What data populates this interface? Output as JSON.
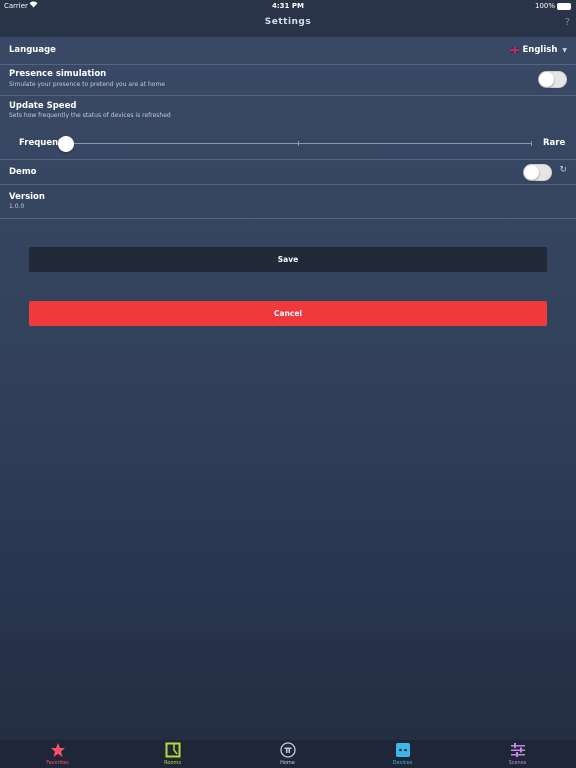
{
  "status_bar": {
    "carrier": "Carrier",
    "time": "4:31 PM",
    "battery": "100%"
  },
  "nav": {
    "title": "Settings",
    "help": "?"
  },
  "settings": {
    "language": {
      "label": "Language",
      "value": "English"
    },
    "presence": {
      "label": "Presence simulation",
      "description": "Simulate your presence to pretend you are at home",
      "enabled": false
    },
    "update_speed": {
      "label": "Update Speed",
      "description": "Sets how frequently the status of devices is refreshed",
      "min_label": "Frequent",
      "max_label": "Rare",
      "value_fraction": 0
    },
    "demo": {
      "label": "Demo",
      "enabled": false
    },
    "version": {
      "label": "Version",
      "value": "1.0.0"
    }
  },
  "buttons": {
    "save": "Save",
    "cancel": "Cancel"
  },
  "tabs": [
    {
      "label": "Favorites",
      "icon": "star-icon",
      "color": "#ff4f6e"
    },
    {
      "label": "Rooms",
      "icon": "room-icon",
      "color": "#b5dc3b"
    },
    {
      "label": "Home",
      "icon": "home-logo-icon",
      "color": "#c3cad6"
    },
    {
      "label": "Devices",
      "icon": "device-icon",
      "color": "#3fb7e6"
    },
    {
      "label": "Scenes",
      "icon": "sliders-icon",
      "color": "#c08ae0"
    }
  ],
  "colors": {
    "accent_cancel": "#f0393d",
    "save_button": "#222a3a",
    "bar_background": "#2a3448"
  }
}
